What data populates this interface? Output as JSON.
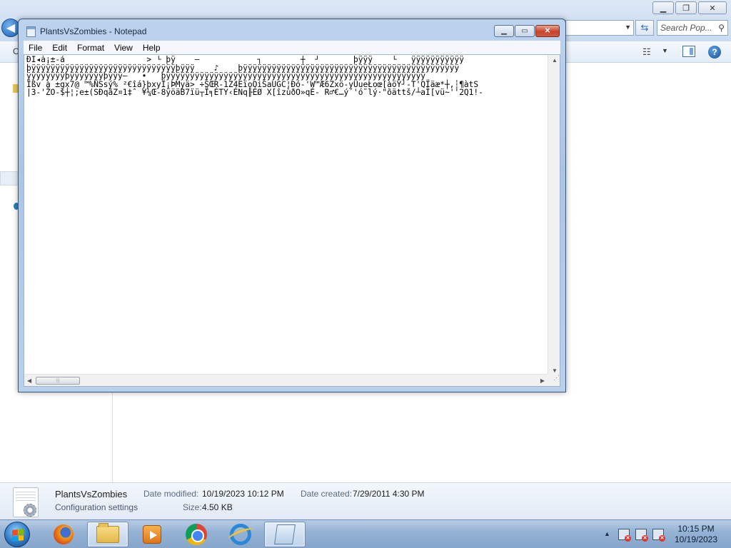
{
  "explorer": {
    "organize_initial": "O",
    "search_placeholder": "Search Pop...",
    "caption_min": "▁",
    "caption_restore": "❐",
    "caption_close": "✕"
  },
  "notepad": {
    "title": "PlantsVsZombies - Notepad",
    "caption_min": "▁",
    "caption_max": "▭",
    "caption_close": "✕",
    "menu": [
      "File",
      "Edit",
      "Format",
      "View",
      "Help"
    ],
    "content": "ÐÏ◂à¡±-á                 > └ þÿ    –            ┐        ┼  ┘       þÿÿÿ    └   ÿÿÿÿÿÿÿÿÿÿÿ\nþÿÿÿÿÿÿÿÿÿÿÿÿÿÿÿÿÿÿÿÿÿÿÿÿÿÿÿÿÿÿþÿÿÿ    ♪    þÿÿÿÿÿÿÿÿÿÿÿÿÿÿÿÿÿÿÿÿÿÿÿÿÿÿÿÿÿÿÿÿÿÿÿÿÿÿÿÿÿÿÿÿÿ\nÿÿÿÿÿÿÿÿþÿÿÿÿÿÿÿþÿÿÿ–   •   þÿÿÿÿÿÿÿÿÿÿÿÿÿÿÿÿÿÿÿÿÿÿÿÿÿÿÿÿÿÿÿÿÿÿÿÿÿÿÿÿÿÿÿÿÿÿÿÿÿÿÿÿÿÿ\nÏßv à ±gx7@ ™%ÑSsý% ²€îá}þxyÏ¡ÞMyä> ÷ŠŒR-1Z4EïoOiŠaUGC¦Ðó-'W™Æ6Zxö-yÜueŁoœ[àöÝ┘-T'QÏäæ*┼,┆¶àtS\n|3-'ŽO-$┼¦;e±(SÐqãZ¤1‡ˆ ¥¼Œ-8ÿöäB7ïü┬Ï╕ÉTY‹ÉNq╟ÉØ X[îzùðO»qÉ- R♂€…ý´'ó˜lý·\"õättš/┴aÌ[vü~''2Q1!-"
  },
  "details": {
    "file_name": "PlantsVsZombies",
    "file_type": "Configuration settings",
    "modified_label": "Date modified:",
    "modified_value": "10/19/2023 10:12 PM",
    "created_label": "Date created:",
    "created_value": "7/29/2011 4:30 PM",
    "size_label": "Size:",
    "size_value": "4.50 KB"
  },
  "taskbar": {
    "time": "10:15 PM",
    "date": "10/19/2023",
    "apps": [
      "firefox-icon",
      "explorer-icon",
      "media-player-icon",
      "chrome-icon",
      "internet-explorer-icon",
      "notepad-icon"
    ]
  }
}
